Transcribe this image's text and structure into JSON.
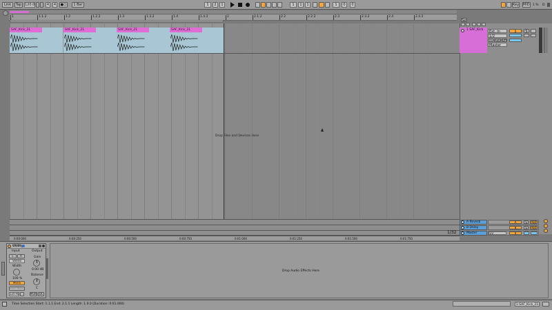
{
  "transport": {
    "link": "Link",
    "tap": "Tap",
    "tempo": "120.00",
    "sig_num": "4",
    "sig_den": "4",
    "metro": "●○",
    "quant": "1 Bar",
    "pos_bar": "1",
    "pos_beat": "2",
    "pos_six": "1",
    "loop_bar": "1",
    "loop_beat": "1",
    "loop_six": "1",
    "len_bar": "1",
    "len_beat": "0",
    "len_six": "0",
    "key": "Key",
    "midi": "MIDI",
    "cpu": "1 %",
    "hd": "D"
  },
  "ruler": {
    "bars": [
      "1",
      "1.1.2",
      "1.2",
      "1.2.2",
      "1.3",
      "1.3.2",
      "1.4",
      "1.4.2",
      "2",
      "2.1.2",
      "2.2",
      "2.2.2",
      "2.3",
      "2.3.2",
      "2.4",
      "2.4.2"
    ],
    "times": [
      "0:00:000",
      "0:00:250",
      "0:00:500",
      "0:00:750",
      "0:01:000",
      "0:01:250",
      "0:01:500",
      "0:01:750"
    ]
  },
  "clips": [
    {
      "name": "SAF_Kick_21"
    },
    {
      "name": "SAF_Kick_21"
    },
    {
      "name": "SAF_Kick_21"
    },
    {
      "name": "SAF_Kick_21"
    }
  ],
  "arrangement": {
    "drop_text": "Drop Files and Devices Here",
    "zoom": "1/32"
  },
  "mixer": {
    "header": "Set",
    "track": {
      "name": "1 SAF_Kick",
      "input": "Ext. In",
      "input_ch": "1/2",
      "monitor_in": "In",
      "monitor_auto": "Auto",
      "monitor_off": "Off",
      "output": "Master",
      "number": "1",
      "solo": "S"
    },
    "returns": [
      {
        "name": "A Reverb",
        "letter": "A",
        "solo": "S",
        "post": "Post",
        "color": "#5b9fd8"
      },
      {
        "name": "B Delay",
        "letter": "B",
        "solo": "S",
        "post": "Post",
        "color": "#5b9fd8"
      },
      {
        "name": "Master",
        "letter": "",
        "solo": "",
        "post": "",
        "color": "#5b9fd8",
        "output": "1/2",
        "cue": "0"
      }
    ]
  },
  "device": {
    "title": "Utility",
    "input_label": "Input",
    "output_label": "Output",
    "left_btn": "L",
    "right_btn": "R",
    "mode": "Stereo",
    "width_label": "Width",
    "width_value": "100 %",
    "mono": "Mono",
    "bass_mono": "Bass Mono",
    "bass_freq": "120 Hz",
    "gain_label": "Gain",
    "gain_value": "0.00 dB",
    "balance_label": "Balance",
    "balance_value": "C",
    "mute": "Mute",
    "dc": "DC",
    "drop_text": "Drop Audio Effects Here"
  },
  "status": {
    "text": "Time Selection   Start: 1.1.1   End: 2.1.1   Length: 1.0.0   (Duration: 0:01.000)",
    "track_name": "1-SAF_Kick_21"
  }
}
